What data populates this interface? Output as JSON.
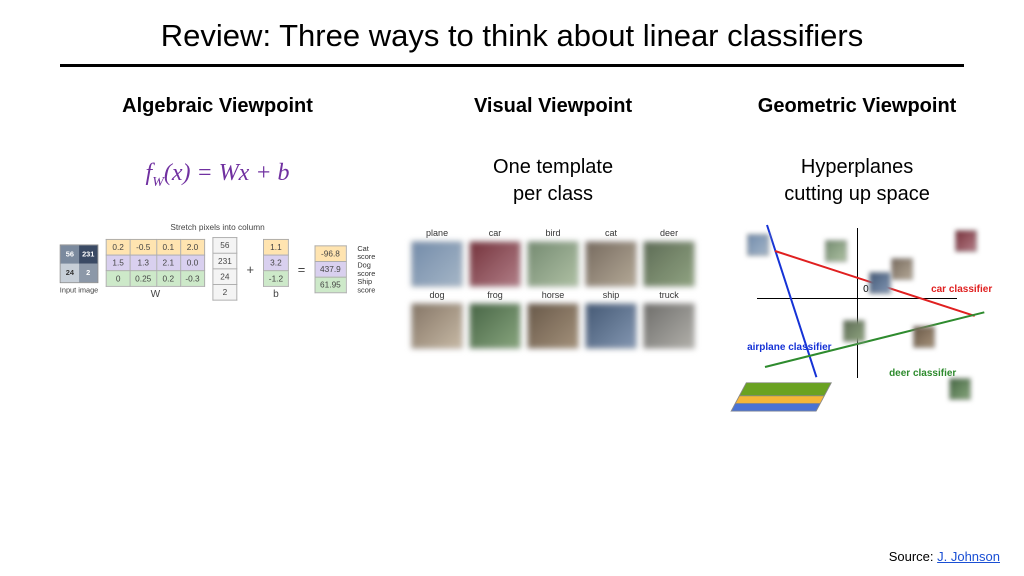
{
  "title": "Review: Three ways to think about linear classifiers",
  "columns": {
    "algebraic": {
      "heading": "Algebraic Viewpoint",
      "formula_f": "f",
      "formula_sub": "W",
      "formula_rest": "(x) =  Wx + b",
      "stretch_label": "Stretch pixels into column",
      "input_label": "Input image",
      "input_pixels": [
        "56",
        "231",
        "24",
        "2"
      ],
      "W_label": "W",
      "b_label": "b",
      "W": [
        [
          "0.2",
          "-0.5",
          "0.1",
          "2.0"
        ],
        [
          "1.5",
          "1.3",
          "2.1",
          "0.0"
        ],
        [
          "0",
          "0.25",
          "0.2",
          "-0.3"
        ]
      ],
      "x": [
        "56",
        "231",
        "24",
        "2"
      ],
      "b": [
        "1.1",
        "3.2",
        "-1.2"
      ],
      "scores": [
        "-96.8",
        "437.9",
        "61.95"
      ],
      "score_labels": [
        "Cat score",
        "Dog score",
        "Ship score"
      ]
    },
    "visual": {
      "heading": "Visual Viewpoint",
      "sub": "One template\nper class",
      "labels": [
        "plane",
        "car",
        "bird",
        "cat",
        "deer",
        "dog",
        "frog",
        "horse",
        "ship",
        "truck"
      ],
      "colors": [
        "linear-gradient(135deg,#6b8db8,#9fb7cf)",
        "linear-gradient(135deg,#8b2d3a,#c27a87)",
        "linear-gradient(135deg,#6f8e6a,#a9c39a)",
        "linear-gradient(135deg,#7b6a5a,#b8a88f)",
        "linear-gradient(135deg,#5a6e4f,#8ba776)",
        "linear-gradient(135deg,#8a7560,#cdb89b)",
        "linear-gradient(135deg,#3f6a3c,#7fa971)",
        "linear-gradient(135deg,#6e5842,#ab9070)",
        "linear-gradient(135deg,#3d5a82,#7d98be)",
        "linear-gradient(135deg,#6f6e6a,#b3b0a8)"
      ]
    },
    "geometric": {
      "heading": "Geometric Viewpoint",
      "sub": "Hyperplanes\ncutting up space",
      "labels": {
        "airplane": "airplane classifier",
        "car": "car classifier",
        "deer": "deer classifier",
        "origin": "0"
      }
    }
  },
  "source": {
    "prefix": "Source: ",
    "link_text": "J. Johnson"
  }
}
